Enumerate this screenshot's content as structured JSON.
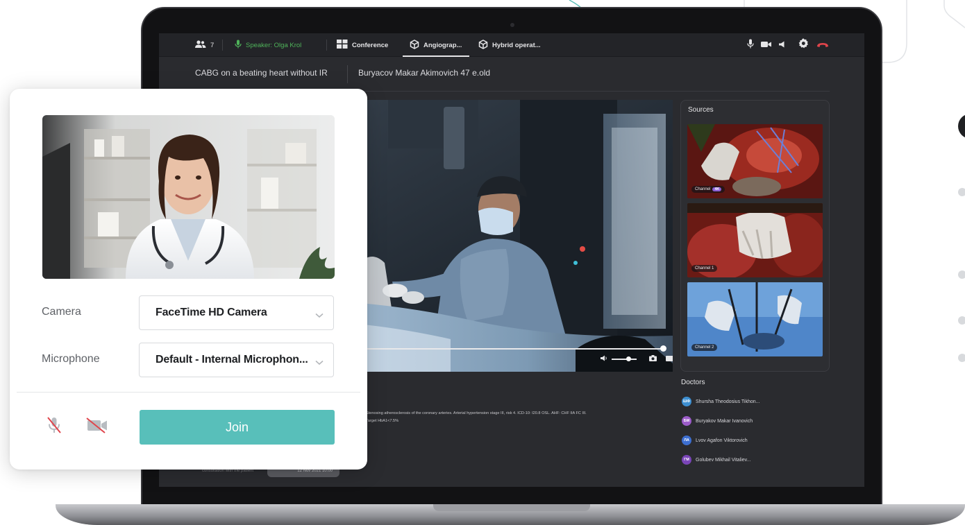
{
  "topbar": {
    "participants_icon": "participants-icon",
    "participants_count": "7",
    "speaker_icon": "microphone-icon",
    "speaker_label": "Speaker: Olga Krol",
    "tabs": [
      {
        "label": "Conference",
        "icon": "grid-icon"
      },
      {
        "label": "Angiograp...",
        "icon": "cube-icon",
        "active": true
      },
      {
        "label": "Hybrid operat...",
        "icon": "cube-icon"
      }
    ],
    "controls": [
      "microphone-icon",
      "camera-icon",
      "speaker-icon",
      "settings-icon",
      "hangup-icon"
    ],
    "hangup_color": "#e0444b",
    "speaker_color": "#4fb35a"
  },
  "titlebar": {
    "procedure": "CABG on a beating heart without IR",
    "patient": "Buryacov Makar Akimovich  47 e.old"
  },
  "video": {
    "progress": 1.0,
    "volume": 0.6,
    "controls": [
      "volume-icon",
      "snapshot-icon",
      "screen-icon",
      "fullscreen-icon"
    ]
  },
  "sources": {
    "title": "Sources",
    "items": [
      {
        "label": "Channel",
        "badge": "4K"
      },
      {
        "label": "Channel 1",
        "badge": ""
      },
      {
        "label": "Channel 2",
        "badge": ""
      }
    ]
  },
  "doctors": {
    "title": "Doctors",
    "items": [
      {
        "initials": "ШФ",
        "name": "Shursha Theodosius Tikhon...",
        "color": "#3d8fd1"
      },
      {
        "initials": "БМ",
        "name": "Buryakov Makar Ivanovich",
        "color": "#9c5cc9"
      },
      {
        "initials": "ЛА",
        "name": "Lvov Agafon Viktorovich",
        "color": "#3d6fd1"
      },
      {
        "initials": "ГМ",
        "name": "Golubev Mikhail Vitaliev...",
        "color": "#7a45b8"
      }
    ]
  },
  "diagnosis": {
    "line1": "Stenosing atherosclerosis of the coronary arteries. Arterial hypertension stage III, risk 4. ICD-10: I20.8 OSL. AHF: CHF IIA FC III.",
    "line2": "Target HbA1<7.5%"
  },
  "bottom": {
    "faint": "consultation with the patient",
    "pill": "12 Nov 2021 10:00"
  },
  "join_card": {
    "camera_label": "Camera",
    "camera_value": "FaceTime HD Camera",
    "microphone_label": "Microphone",
    "microphone_value": "Default - Internal Microphon...",
    "join_label": "Join",
    "join_color": "#58bfba",
    "mic_toggle_icon": "microphone-off-icon",
    "camera_toggle_icon": "camera-off-icon",
    "off_slash_color": "#e0444b"
  }
}
